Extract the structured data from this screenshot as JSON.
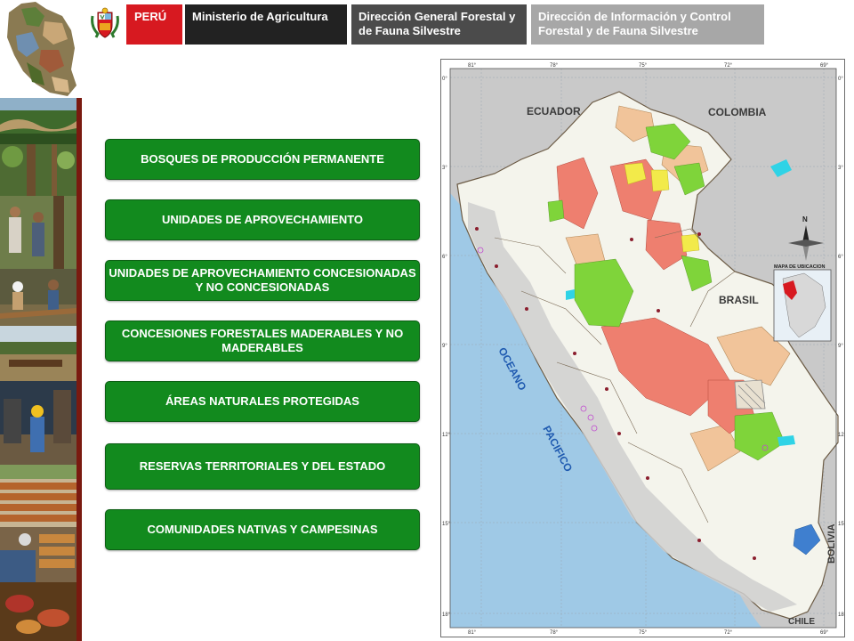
{
  "header": {
    "country": "PERÚ",
    "ministry": "Ministerio de Agricultura",
    "directorate": "Dirección General Forestal y de Fauna Silvestre",
    "office": "Dirección de Información y Control Forestal y de Fauna Silvestre"
  },
  "categories": [
    "BOSQUES DE PRODUCCIÓN PERMANENTE",
    "UNIDADES DE APROVECHAMIENTO",
    "UNIDADES DE APROVECHAMIENTO CONCESIONADAS Y NO CONCESIONADAS",
    "CONCESIONES FORESTALES MADERABLES Y NO MADERABLES",
    "ÁREAS NATURALES PROTEGIDAS",
    "RESERVAS TERRITORIALES Y DEL ESTADO",
    "COMUNIDADES NATIVAS Y CAMPESINAS"
  ],
  "map": {
    "labels": {
      "ecuador": "ECUADOR",
      "colombia": "COLOMBIA",
      "brasil": "BRASIL",
      "bolivia": "BOLIVIA",
      "chile": "CHILE",
      "oceano": "OCEANO",
      "pacifico": "PACIFICO",
      "north": "N",
      "inset_title": "MAPA DE UBICACION"
    },
    "longitude_ticks": [
      "81°",
      "78°",
      "75°",
      "72°",
      "69°"
    ],
    "latitude_ticks": [
      "0°",
      "3°",
      "6°",
      "9°",
      "12°",
      "15°",
      "18°"
    ],
    "colors": {
      "ocean": "#9fc9e6",
      "land_grey": "#c9c9c9",
      "peru_base": "#f4f4ec",
      "concession_green": "#7fd43a",
      "production_red": "#ee7f6f",
      "native_tan": "#f1c49a",
      "reserve_yellow": "#f2ea4a",
      "lake_cyan": "#2fd3e6"
    }
  }
}
